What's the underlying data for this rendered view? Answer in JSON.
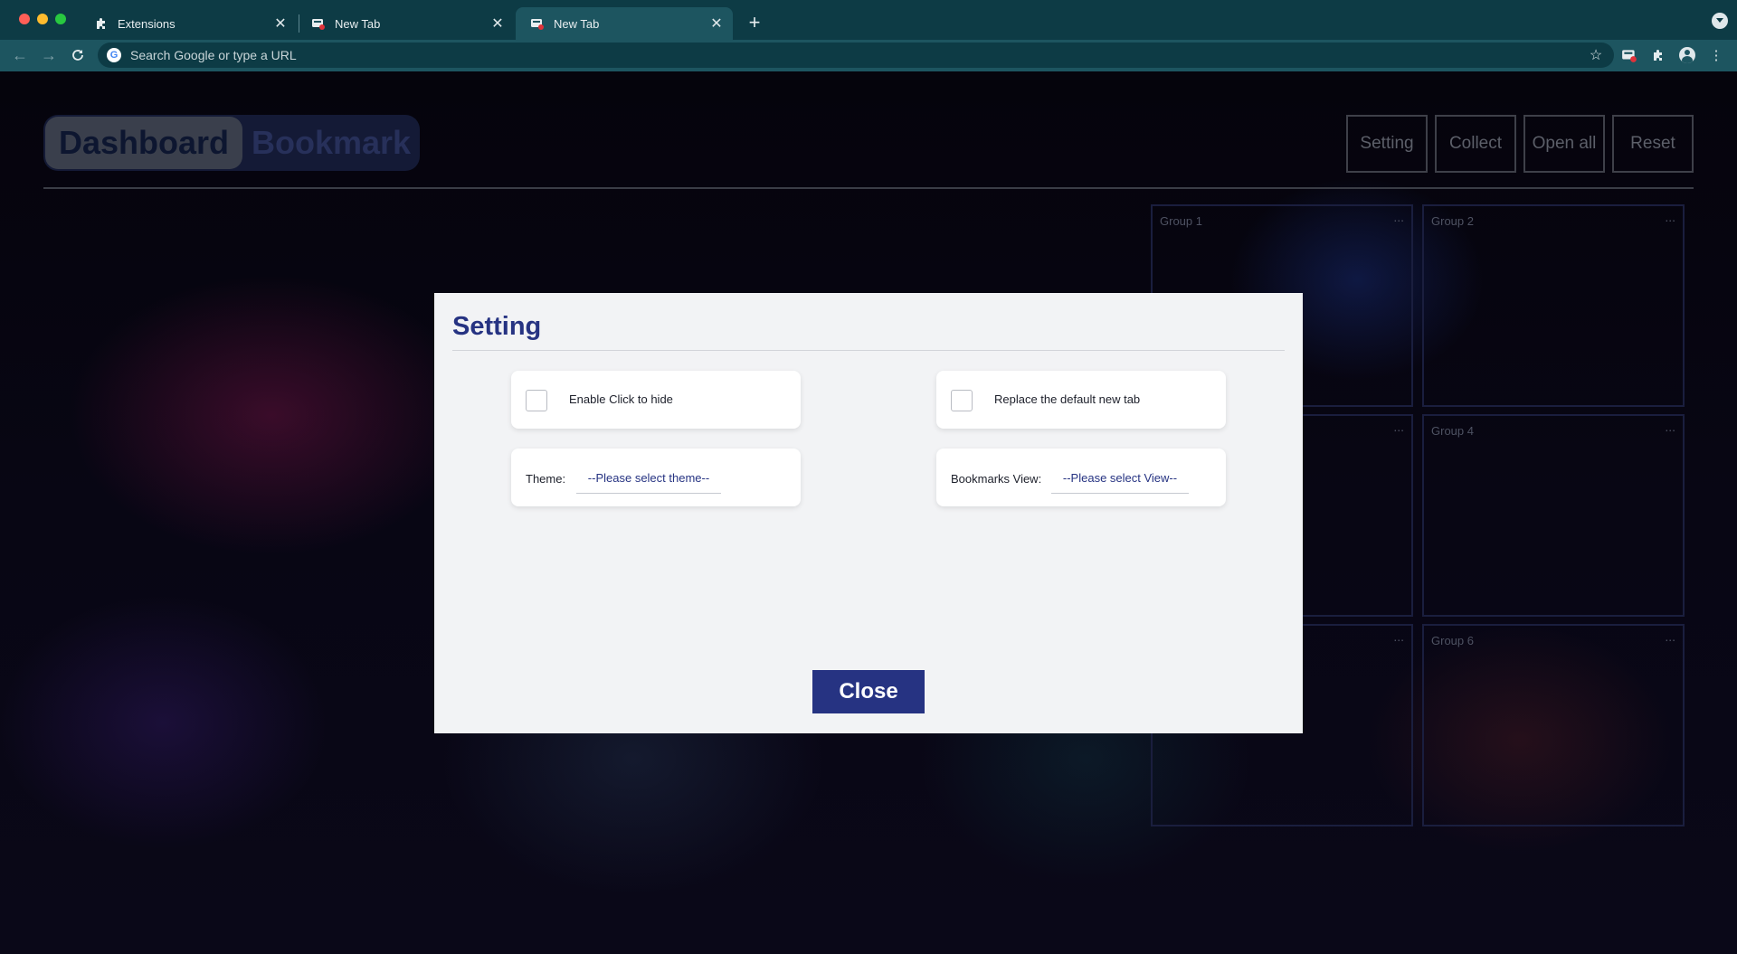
{
  "browser": {
    "tabs": [
      {
        "title": "Extensions",
        "icon": "puzzle-icon",
        "close": "✕"
      },
      {
        "title": "New Tab",
        "icon": "extension-favicon",
        "close": "✕"
      },
      {
        "title": "New Tab",
        "icon": "extension-favicon",
        "close": "✕",
        "active": true
      }
    ],
    "new_tab": "+",
    "omnibox": {
      "placeholder": "Search Google or type a URL",
      "value": ""
    },
    "icons": [
      "back-icon",
      "forward-icon",
      "reload-icon",
      "google-icon",
      "star-icon",
      "extension-icon",
      "puzzle-icon",
      "profile-icon",
      "menu-icon"
    ],
    "colors": {
      "chrome_dark": "#0d3b45",
      "chrome_light": "#1d5560"
    }
  },
  "dashboard": {
    "segments": {
      "active": "Dashboard",
      "inactive": "Bookmark"
    },
    "actions": {
      "setting": "Setting",
      "collect": "Collect",
      "open_all": "Open all",
      "reset": "Reset"
    },
    "groups": [
      {
        "title": "Group 1",
        "more": "..."
      },
      {
        "title": "Group 2",
        "more": "..."
      },
      {
        "title": "",
        "more": "..."
      },
      {
        "title": "Group 4",
        "more": "..."
      },
      {
        "title": "",
        "more": "..."
      },
      {
        "title": "Group 6",
        "more": "..."
      }
    ]
  },
  "modal": {
    "title": "Setting",
    "enable_click_to_hide": {
      "label": "Enable Click to hide",
      "checked": false
    },
    "replace_new_tab": {
      "label": "Replace the default new tab",
      "checked": false
    },
    "theme": {
      "label": "Theme:",
      "selected": "--Please select theme--"
    },
    "bookmarks_view": {
      "label": "Bookmarks View:",
      "selected": "--Please select View--"
    },
    "close": "Close",
    "colors": {
      "accent": "#263382",
      "background": "#f2f3f5"
    }
  }
}
